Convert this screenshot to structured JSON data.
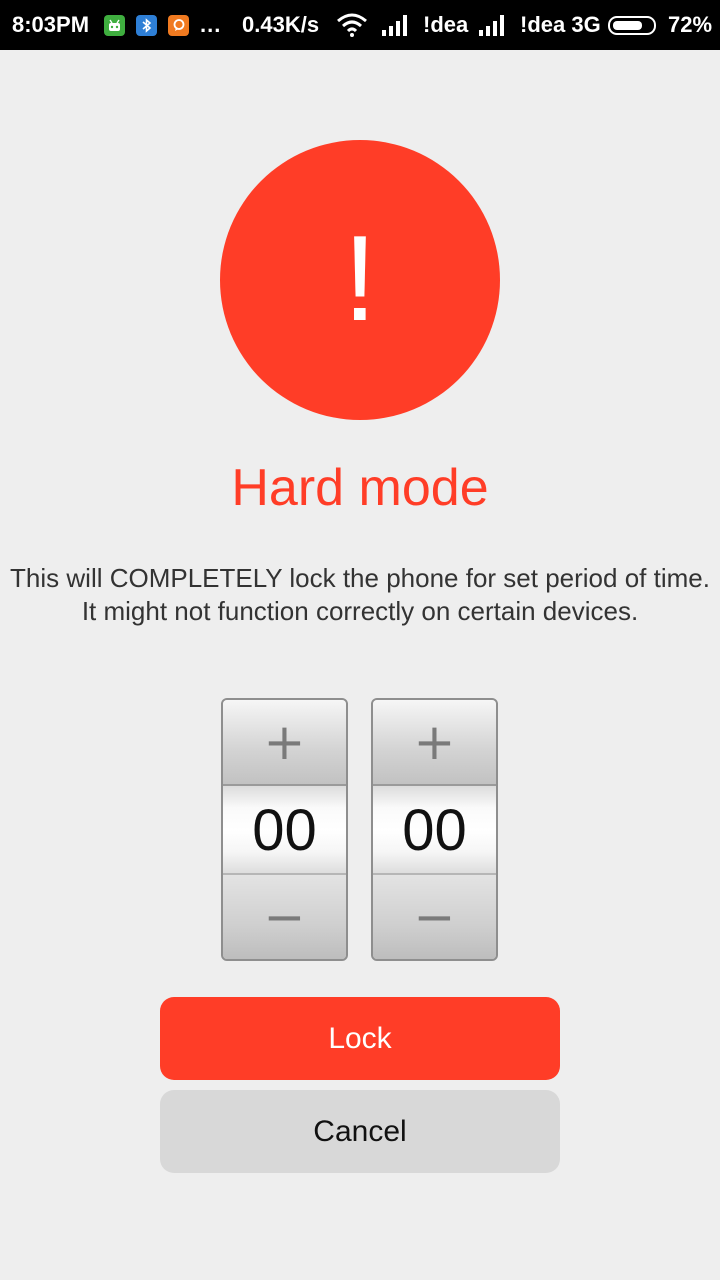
{
  "status_bar": {
    "time": "8:03PM",
    "icons": [
      "android-notification-icon",
      "bluetooth-notification-icon",
      "chat-notification-icon"
    ],
    "more": "...",
    "speed": "0.43K/s",
    "carrier1": "!dea",
    "carrier2": "!dea 3G",
    "battery_pct": "72%",
    "battery_level": 0.72
  },
  "warning": {
    "symbol": "!",
    "color": "#ff3d27"
  },
  "title": "Hard mode",
  "description": {
    "line1": "This will COMPLETELY lock the phone for set period of time.",
    "line2": "It might not function correctly on certain devices."
  },
  "pickers": [
    {
      "plus": "+",
      "value": "00",
      "minus": "−"
    },
    {
      "plus": "+",
      "value": "00",
      "minus": "−"
    }
  ],
  "buttons": {
    "lock": "Lock",
    "cancel": "Cancel"
  },
  "colors": {
    "accent": "#ff3d27",
    "cancel_bg": "#d8d8d8",
    "background": "#eeeeee"
  }
}
